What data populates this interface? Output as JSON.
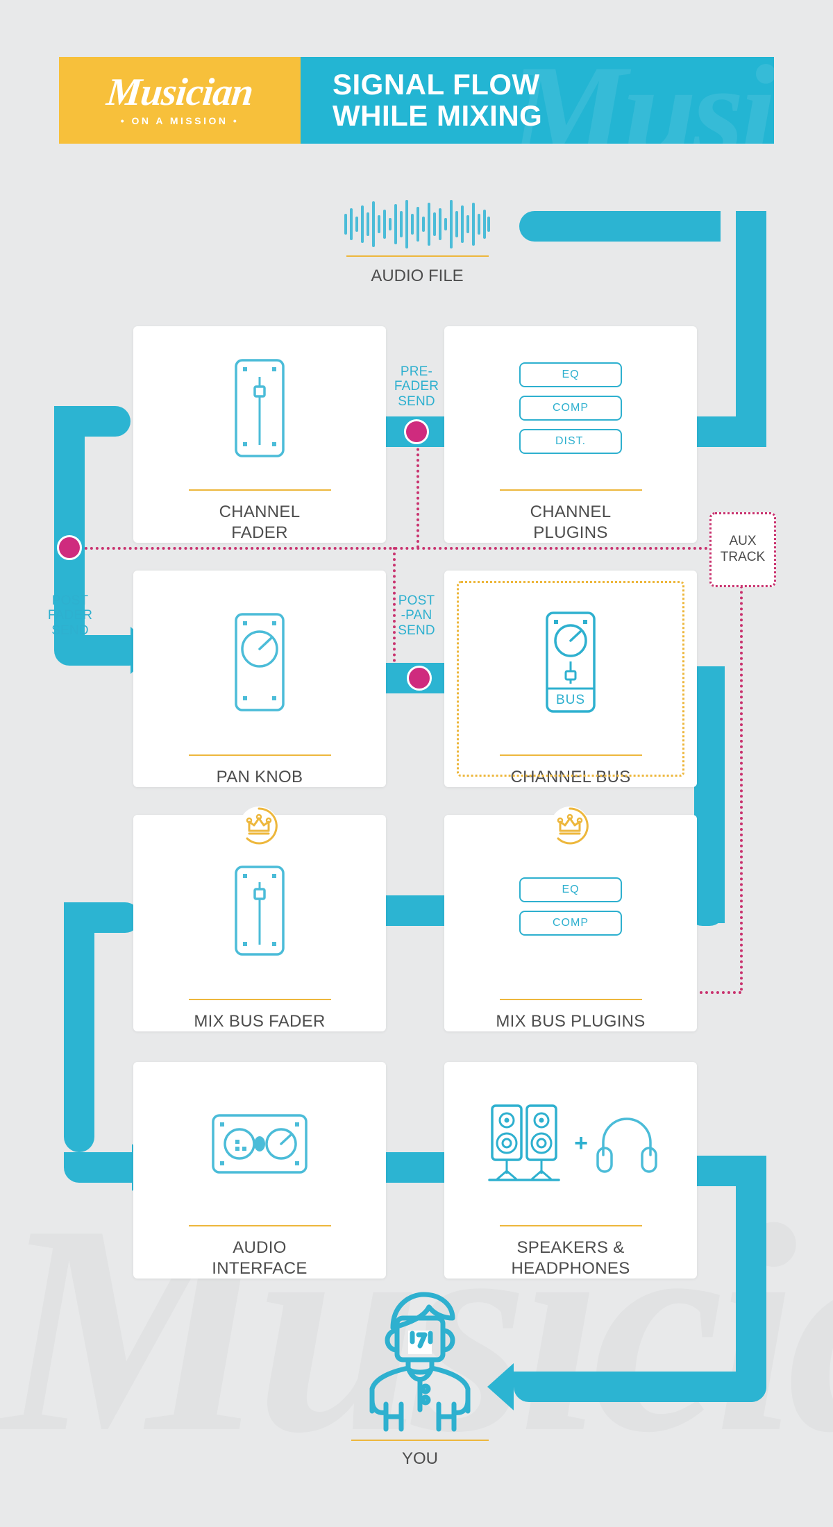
{
  "header": {
    "logo_script": "Musician",
    "logo_tagline": "• ON A MISSION •",
    "title_line1": "SIGNAL FLOW",
    "title_line2": "WHILE MIXING",
    "watermark_text": "Musician",
    "brand_yellow": "#f7c03b",
    "brand_teal": "#23b5d3",
    "brand_pink": "#cf2b7e",
    "brand_gold": "#edb73c",
    "page_bg": "#e8e9ea"
  },
  "nodes": {
    "audio_file": {
      "label": "AUDIO FILE",
      "icon": "waveform-icon"
    },
    "channel_plugins": {
      "label_line1": "CHANNEL",
      "label_line2": "PLUGINS",
      "plugins": [
        "EQ",
        "COMP",
        "DIST."
      ]
    },
    "channel_fader": {
      "label_line1": "CHANNEL",
      "label_line2": "FADER",
      "icon": "fader-icon"
    },
    "pan_knob": {
      "label": "PAN KNOB",
      "icon": "pan-knob-icon"
    },
    "channel_bus": {
      "label": "CHANNEL BUS",
      "icon": "bus-icon",
      "icon_text": "BUS"
    },
    "mix_bus_plugins": {
      "label": "MIX BUS PLUGINS",
      "plugins": [
        "EQ",
        "COMP"
      ],
      "badge": "crown-icon"
    },
    "mix_bus_fader": {
      "label": "MIX BUS FADER",
      "icon": "fader-icon",
      "badge": "crown-icon"
    },
    "audio_interface": {
      "label_line1": "AUDIO",
      "label_line2": "INTERFACE",
      "icon": "audio-interface-icon"
    },
    "speakers_headphones": {
      "label_line1": "SPEAKERS &",
      "label_line2": "HEADPHONES",
      "icon_speakers": "studio-monitors-icon",
      "icon_plus": "+",
      "icon_headphones": "headphones-icon"
    },
    "you": {
      "label": "YOU",
      "icon": "person-icon"
    },
    "aux_track": {
      "label_line1": "AUX",
      "label_line2": "TRACK"
    }
  },
  "sends": {
    "pre_fader": {
      "line1": "PRE-",
      "line2": "FADER",
      "line3": "SEND"
    },
    "post_fader": {
      "line1": "POST",
      "line2": "FADER",
      "line3": "SEND"
    },
    "post_pan": {
      "line1": "POST",
      "line2": "-PAN",
      "line3": "SEND"
    }
  }
}
